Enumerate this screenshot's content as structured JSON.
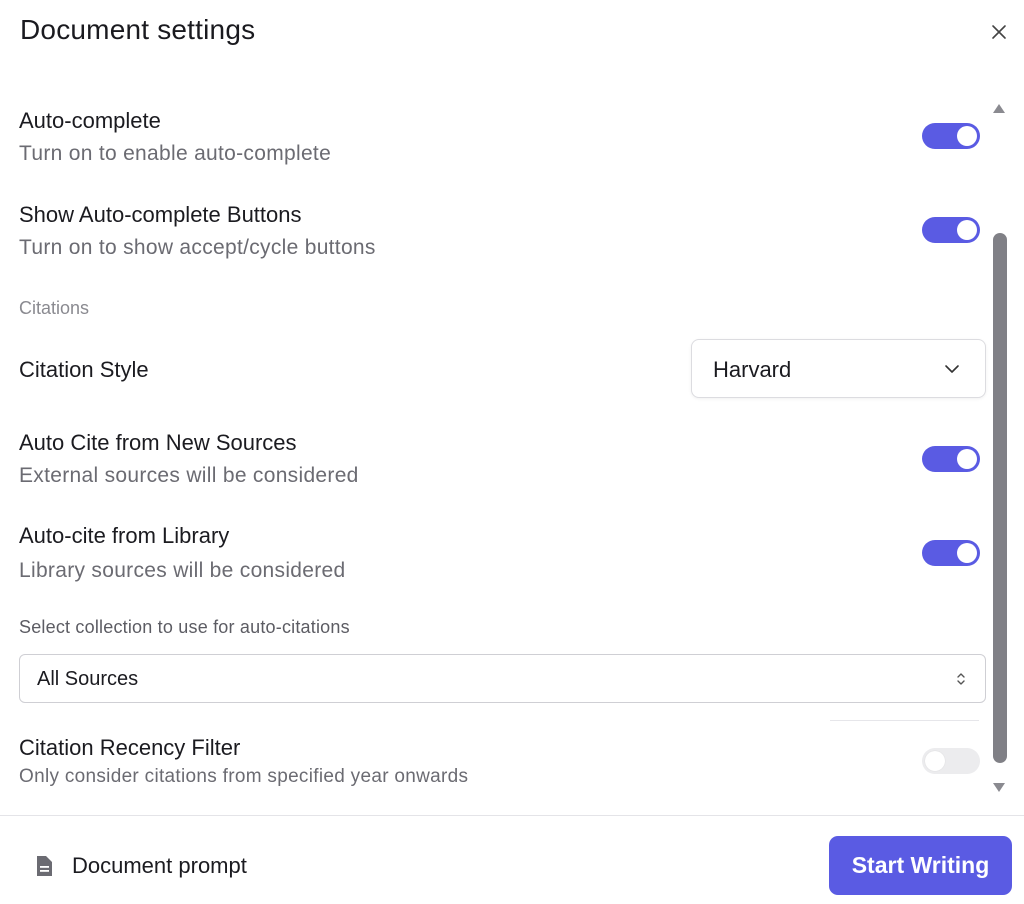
{
  "dialog": {
    "title": "Document settings",
    "close_icon": "close-icon"
  },
  "settings": {
    "autocomplete": {
      "title": "Auto-complete",
      "description": "Turn on to enable auto-complete",
      "enabled": true
    },
    "autocomplete_buttons": {
      "title": "Show Auto-complete Buttons",
      "description": "Turn on to show accept/cycle buttons",
      "enabled": true
    }
  },
  "citations": {
    "section_label": "Citations",
    "style": {
      "label": "Citation Style",
      "value": "Harvard"
    },
    "auto_cite_new": {
      "title": "Auto Cite from New Sources",
      "description": "External sources will be considered",
      "enabled": true
    },
    "auto_cite_library": {
      "title": "Auto-cite from Library",
      "description": "Library sources will be considered",
      "enabled": true
    },
    "collection": {
      "label": "Select collection to use for auto-citations",
      "value": "All Sources"
    },
    "recency_filter": {
      "title": "Citation Recency Filter",
      "description": "Only consider citations from specified year onwards",
      "enabled": false
    }
  },
  "footer": {
    "doc_prompt_label": "Document prompt",
    "start_button": "Start Writing"
  },
  "colors": {
    "accent": "#5a5be3",
    "toggle_off": "#ececee",
    "scrollbar": "#808086"
  }
}
